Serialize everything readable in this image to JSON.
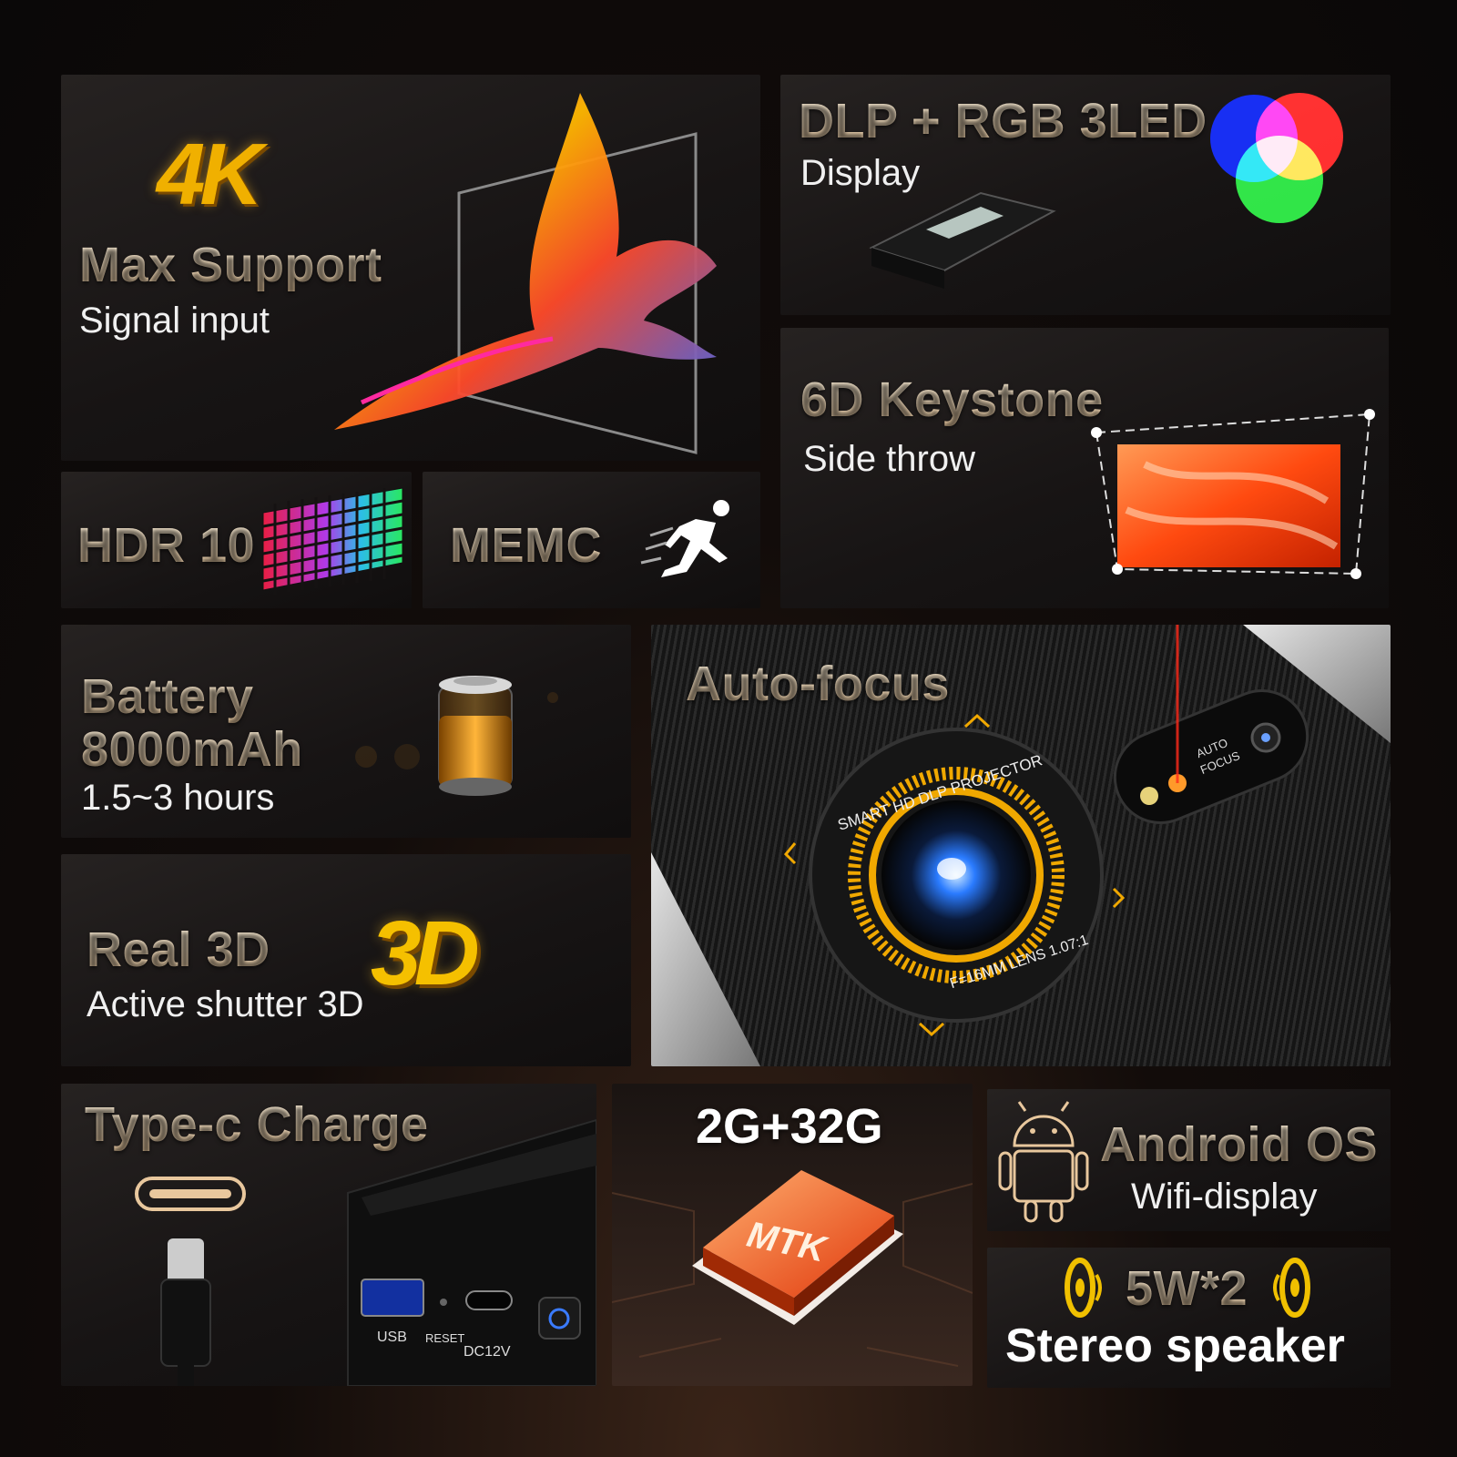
{
  "tiles": {
    "max_support": {
      "badge": "4K",
      "title": "Max Support",
      "subtitle": "Signal input"
    },
    "dlp": {
      "title": "DLP + RGB 3LED",
      "subtitle": "Display"
    },
    "keystone": {
      "title": "6D Keystone",
      "subtitle": "Side throw"
    },
    "hdr": {
      "title": "HDR 10"
    },
    "memc": {
      "title": "MEMC"
    },
    "battery": {
      "title": "Battery",
      "capacity": "8000mAh",
      "runtime": "1.5~3 hours"
    },
    "autofocus": {
      "title": "Auto-focus",
      "lens_ring_top": "SMART HD DLP PROJECTOR",
      "lens_ring_bottom": "F=16MM LENS 1.07:1",
      "sensor_label_1": "AUTO",
      "sensor_label_2": "FOCUS"
    },
    "real3d": {
      "badge": "3D",
      "title": "Real 3D",
      "subtitle": "Active shutter 3D"
    },
    "typec": {
      "title": "Type-c Charge",
      "port_usb": "USB",
      "port_reset": "RESET",
      "port_dc": "DC12V"
    },
    "memory": {
      "title": "2G+32G",
      "chip": "MTK"
    },
    "android": {
      "title": "Android OS",
      "subtitle": "Wifi-display"
    },
    "speaker": {
      "title": "5W*2",
      "subtitle": "Stereo speaker"
    }
  },
  "colors": {
    "gold_text": "#f3e1c2",
    "accent_gold": "#f0a800",
    "accent_orange": "#ff6a1a",
    "bg": "#0a0808"
  }
}
